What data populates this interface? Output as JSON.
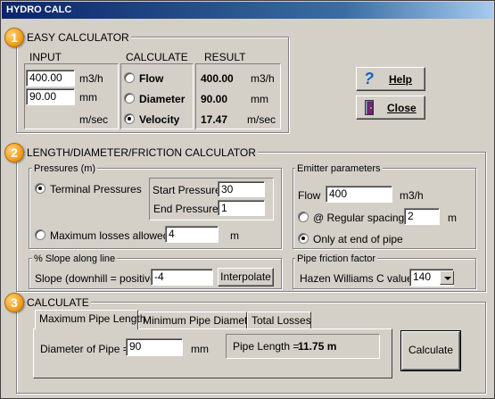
{
  "window": {
    "title": "HYDRO CALC"
  },
  "badges": [
    "1",
    "2",
    "3"
  ],
  "easy": {
    "title": "EASY CALCULATOR",
    "input_header": "INPUT",
    "calculate_header": "CALCULATE",
    "result_header": "RESULT",
    "flow_value": "400.00",
    "flow_unit": "m3/h",
    "diameter_value": "90.00",
    "diameter_unit": "mm",
    "velocity_unit": "m/sec",
    "radio_flow": "Flow",
    "radio_diameter": "Diameter",
    "radio_velocity": "Velocity",
    "selected": "Velocity",
    "result_flow": "400.00",
    "result_flow_unit": "m3/h",
    "result_diameter": "90.00",
    "result_diameter_unit": "mm",
    "result_velocity": "17.47",
    "result_velocity_unit": "m/sec"
  },
  "buttons": {
    "help": "Help",
    "close": "Close"
  },
  "ldf": {
    "title": "LENGTH/DIAMETER/FRICTION CALCULATOR",
    "pressures": {
      "title": "Pressures (m)",
      "terminal_label": "Terminal Pressures",
      "start_label": "Start Pressure",
      "start_value": "30",
      "end_label": "End Pressure",
      "end_value": "1",
      "max_losses_label": "Maximum losses allowed",
      "max_losses_value": "4",
      "max_losses_unit": "m",
      "selected": "Terminal Pressures"
    },
    "emitter": {
      "title": "Emitter parameters",
      "flow_label": "Flow",
      "flow_value": "400",
      "flow_unit": "m3/h",
      "regular_label": "@ Regular spacing",
      "regular_value": "2",
      "regular_unit": "m",
      "end_label": "Only at end of pipe",
      "selected": "Only at end of pipe"
    },
    "slope": {
      "title": "% Slope along line",
      "label": "Slope (downhill = positive)",
      "value": "-4",
      "button": "Interpolate"
    },
    "friction": {
      "title": "Pipe friction factor",
      "label": "Hazen Williams C value",
      "value": "140"
    }
  },
  "calc": {
    "title": "CALCULATE",
    "tabs": [
      "Maximum Pipe Length",
      "Minimum Pipe Diameter",
      "Total Losses"
    ],
    "active_tab": "Maximum Pipe Length",
    "diameter_label": "Diameter of Pipe =",
    "diameter_value": "90",
    "diameter_unit": "mm",
    "result_label": "Pipe Length =",
    "result_value": "11.75 m",
    "button": "Calculate"
  },
  "colors": {
    "face": "#d4d0c8",
    "title_start": "#0a246a",
    "title_end": "#a6caf0",
    "badge": "#f0a020",
    "help_icon": "#1565c0",
    "close_icon": "#7a1f8a"
  },
  "icons": {
    "help": "question-mark-icon",
    "close": "door-exit-icon"
  }
}
